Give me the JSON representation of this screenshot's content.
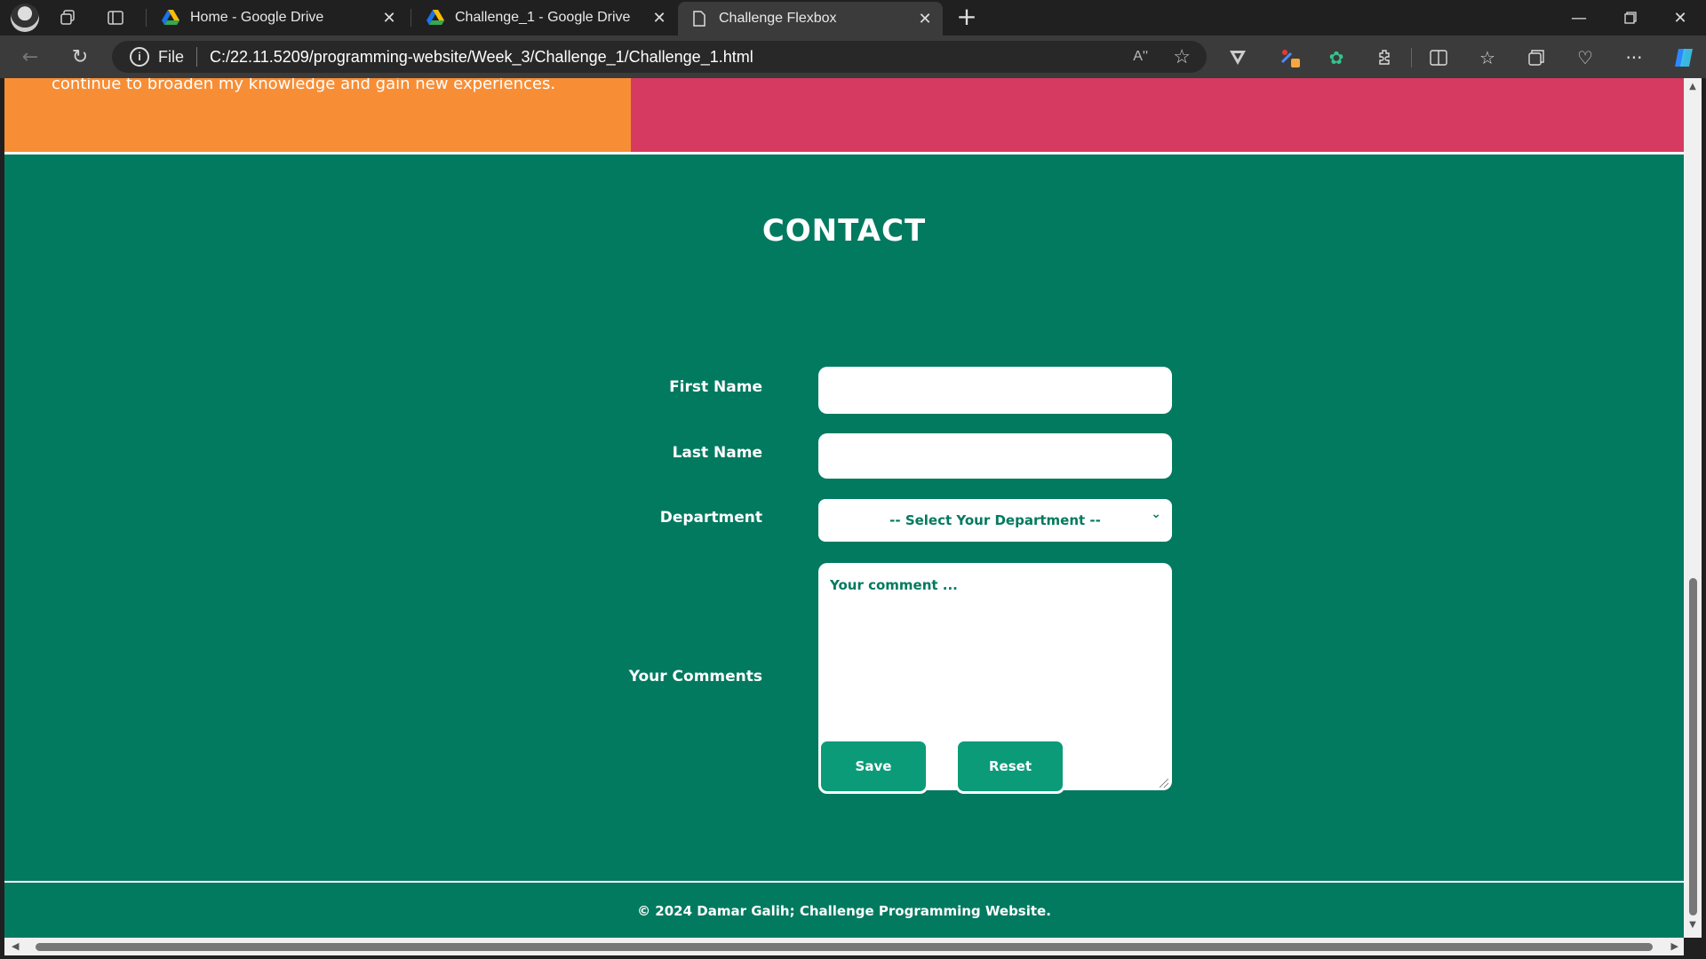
{
  "browser": {
    "tabs": [
      {
        "title": "Home - Google Drive",
        "icon": "google-drive-icon"
      },
      {
        "title": "Challenge_1 - Google Drive",
        "icon": "google-drive-icon"
      },
      {
        "title": "Challenge Flexbox",
        "icon": "document-icon",
        "active": true
      }
    ],
    "address": {
      "scheme_label": "File",
      "url": "C:/22.11.5209/programming-website/Week_3/Challenge_1/Challenge_1.html"
    },
    "read_aloud_label": "Aʹʹ"
  },
  "page": {
    "about_text": "continue to broaden my knowledge and gain new experiences.",
    "contact": {
      "title": "CONTACT",
      "first_name_label": "First Name",
      "last_name_label": "Last Name",
      "department_label": "Department",
      "department_selected": "-- Select Your Department --",
      "comments_label": "Your Comments",
      "comments_placeholder": "Your comment ...",
      "save_label": "Save",
      "reset_label": "Reset"
    },
    "footer": "© 2024 Damar Galih; Challenge Programming Website."
  },
  "colors": {
    "about_orange": "#f78e36",
    "about_pink": "#d63a60",
    "contact_green": "#027a60",
    "button_green": "#0c9b78"
  }
}
